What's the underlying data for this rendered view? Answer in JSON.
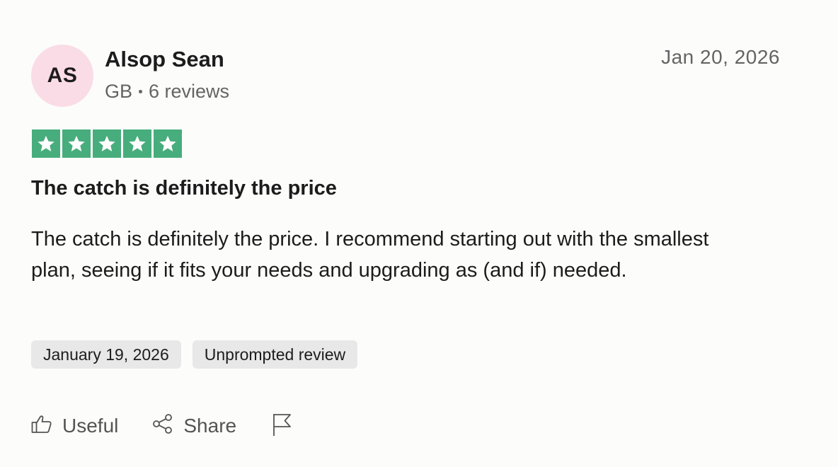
{
  "reviewer": {
    "initials": "AS",
    "name": "Alsop Sean",
    "country": "GB",
    "review_count": "6 reviews",
    "avatar_color": "#fadce6"
  },
  "review": {
    "date": "Jan 20, 2026",
    "rating": 5,
    "rating_max": 5,
    "star_color": "#47ad7c",
    "title": "The catch is definitely the price",
    "body": "The catch is definitely the price. I recommend starting out with the smallest plan, seeing if it fits your needs and upgrading as (and if) needed.",
    "tags": [
      {
        "label": "January 19, 2026"
      },
      {
        "label": "Unprompted review"
      }
    ]
  },
  "actions": {
    "useful": {
      "label": "Useful",
      "icon": "thumbs-up-icon"
    },
    "share": {
      "label": "Share",
      "icon": "share-icon"
    },
    "report": {
      "icon": "flag-icon"
    }
  }
}
